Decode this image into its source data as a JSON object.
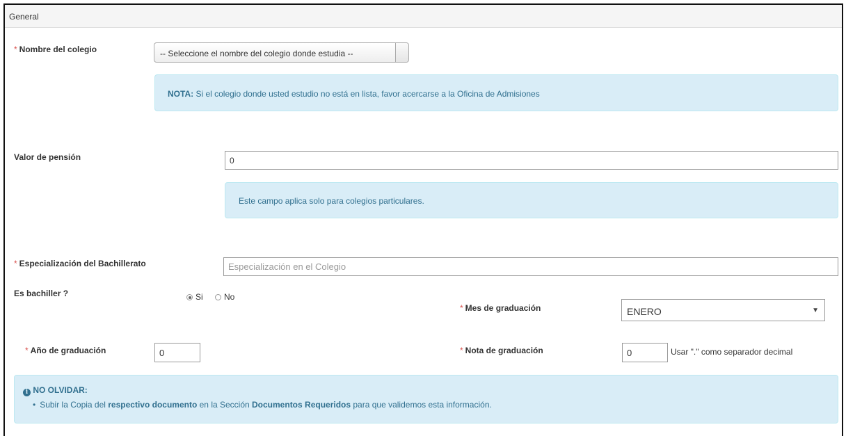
{
  "panel": {
    "title": "General"
  },
  "required_mark": "*",
  "colegio": {
    "label": "Nombre del colegio",
    "select_value": "-- Seleccione el nombre del colegio donde estudia --",
    "note_prefix": "NOTA:",
    "note_text": " Si el colegio donde usted estudio no está en lista, favor acercarse a la Oficina de Admisiones"
  },
  "pension": {
    "label": "Valor de pensión",
    "value": "0",
    "note": "Este campo aplica solo para colegios particulares."
  },
  "especializacion": {
    "label": "Especialización del Bachillerato",
    "placeholder": "Especialización en el Colegio"
  },
  "bachiller": {
    "label": "Es bachiller ?",
    "options": [
      {
        "label": "Si",
        "selected": true
      },
      {
        "label": "No",
        "selected": false
      }
    ]
  },
  "mes": {
    "label": "Mes de graduación",
    "value": "ENERO"
  },
  "anio": {
    "label": "Año de graduación",
    "value": "0"
  },
  "nota_grad": {
    "label": "Nota de graduación",
    "value": "0",
    "hint": "Usar \".\" como separador decimal"
  },
  "reminder": {
    "title": "NO OLVIDAR:",
    "text_1": "Subir la Copia del ",
    "bold_1": "respectivo documento",
    "text_2": " en la Sección ",
    "bold_2": "Documentos Requeridos",
    "text_3": " para que validemos esta información."
  },
  "colors": {
    "info_bg": "#d9edf7",
    "info_border": "#bce8f1",
    "info_text": "#31708f",
    "required": "#d9534f"
  },
  "icons": {
    "reminder": "info-circle-icon",
    "dropdown": "caret-down-icon"
  }
}
